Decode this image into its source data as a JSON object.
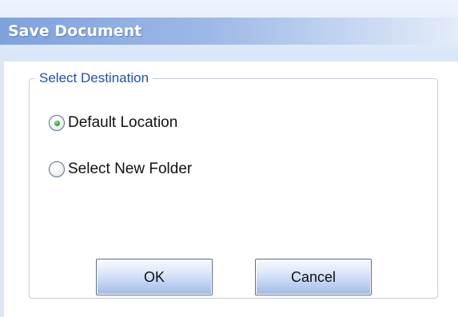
{
  "window": {
    "title": "Save Document"
  },
  "destination": {
    "legend": "Select Destination",
    "options": [
      {
        "label": "Default Location",
        "selected": true
      },
      {
        "label": "Select New Folder",
        "selected": false
      }
    ]
  },
  "buttons": {
    "ok_label": "OK",
    "cancel_label": "Cancel"
  },
  "colors": {
    "title_text": "#ffffff",
    "legend_text": "#1f4fb5",
    "radio_selected": "#3aa634"
  }
}
